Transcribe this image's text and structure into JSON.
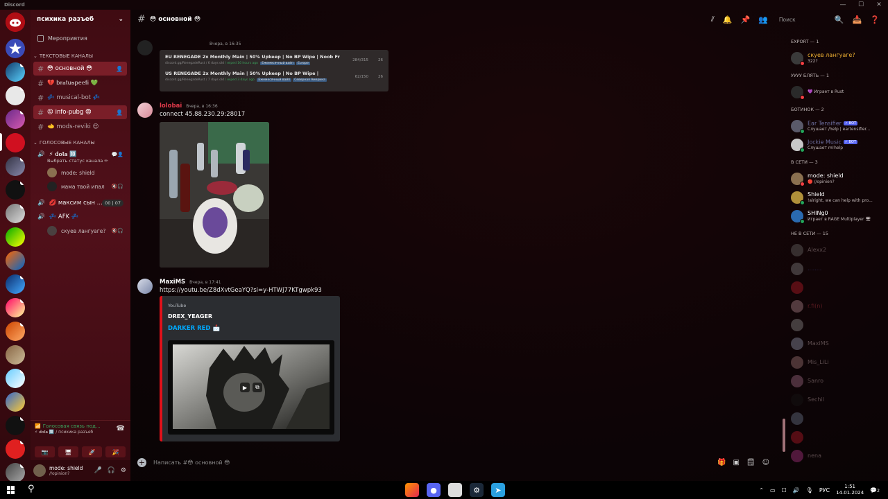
{
  "window": {
    "title": "Discord",
    "controls": [
      "—",
      "☐",
      "✕"
    ]
  },
  "server": {
    "name": "психика разъеб",
    "events_label": "Мероприятия"
  },
  "categories": {
    "text": "ТЕКСТОВЫЕ КАНАЛЫ",
    "voice": "ГОЛОСОВЫЕ КАНАЛЫ"
  },
  "text_channels": [
    {
      "label": "😳 основной 😳",
      "active": true
    },
    {
      "label": "💔 𝐛𝐫𝐚𝐭𝐮𝐬𝐩𝐞𝐞𝐟𝐢 💚",
      "active": false
    },
    {
      "label": "💤 musical-bot 💤",
      "active": false
    },
    {
      "label": "😡 info-pubg 😨",
      "active": true
    },
    {
      "label": "🫲 mods-reviki 😍",
      "active": false
    }
  ],
  "voice_channels": {
    "dota": {
      "label": "⚡ 𝐝𝐨𝐭𝐚 🔟",
      "status": "Выбрать статус канала ✏",
      "users": [
        "mode: shield",
        "мама твой ипал"
      ]
    },
    "maksim": {
      "label": "💋 максим сын ...",
      "counter": [
        "00",
        "07"
      ]
    },
    "afk": {
      "label": "💤 AFK 💤",
      "users": [
        "скуев лангуаге?"
      ]
    }
  },
  "voice_panel": {
    "status": "Голосовая связь под...",
    "sub": "⚡ 𝐝𝐨𝐭𝐚 🔟 / психика разъеб"
  },
  "user_panel": {
    "name": "mode: shield",
    "status": "//opinion?"
  },
  "channel": {
    "name": "😳 основной 😳",
    "search_placeholder": "Поиск",
    "composer_placeholder": "Написать #😳 основной 😳"
  },
  "messages": {
    "server_list_bot": {
      "time": "Вчера, в 16:35",
      "rows": [
        {
          "title": "EU RENEGADE 2x Monthly Main | 50% Upkeep | No BP Wipe | Noob Fr",
          "link": "discord.gg/RenegadeRust",
          "age": "/ 6 days old",
          "wiped": "/ wiped 16 hours ago",
          "tag1": "Ежемесячный вайп",
          "tag2": "Europe",
          "players": "284/315",
          "queue": "26"
        },
        {
          "title": "US RENEGADE 2x Monthly Main | 50% Upkeep | No BP Wipe |",
          "link": "discord.gg/RenegadeRust",
          "age": "/ 7 days old",
          "wiped": "/ wiped 3 days ago",
          "tag1": "Ежемесячный вайп",
          "tag2": "Северная Америка",
          "players": "62/150",
          "queue": "26"
        }
      ]
    },
    "lolobai": {
      "author": "lolobai",
      "author_color": "#e03a4a",
      "time": "Вчера, в 16:36",
      "text": "connect 45.88.230.29:28017"
    },
    "maxims": {
      "author": "MaxiMS",
      "author_color": "#ffffff",
      "time": "Вчера, в 17:41",
      "link": "https://youtu.be/Z8dXvtGeaYQ?si=y-HTWj77KTgwpk93",
      "embed": {
        "provider": "YouTube",
        "channel": "DREX_YEAGER",
        "title": "DARKER RED 📩"
      }
    }
  },
  "members": {
    "export": {
      "header": "EXPORT — 1",
      "list": [
        {
          "name": "скуев лангуаге?",
          "activity": "322?",
          "color": "#f0b132",
          "status": "#f23f43"
        }
      ]
    },
    "yyyy": {
      "header": "УУУУ БЛЯТЬ — 1",
      "list": [
        {
          "name": "",
          "activity": "💜 Играет в Rust",
          "color": "#ffffff",
          "status": "#f23f43"
        }
      ]
    },
    "botinok": {
      "header": "БОТИНОК — 2",
      "list": [
        {
          "name": "Ear Tensifier",
          "activity": "Слушает /help | eartensifier...",
          "color": "#6d6f9f",
          "status": "#23a55a",
          "bot": "✓ BOT"
        },
        {
          "name": "Jockie Music",
          "activity": "Слушает m!help",
          "color": "#6d6f9f",
          "status": "#23a55a",
          "bot": "✓ BOT"
        }
      ]
    },
    "online": {
      "header": "В СЕТИ — 3",
      "list": [
        {
          "name": "mode: shield",
          "activity": "🔴 //opinion?",
          "color": "#ffffff",
          "status": "#f23f43"
        },
        {
          "name": "Shield",
          "activity": "!alright, we can help with pro...",
          "color": "#ffffff",
          "status": "#23a55a"
        },
        {
          "name": "SHINg0",
          "activity": "Играет в RAGE Multiplayer 🖥",
          "color": "#ffffff",
          "status": "#23a55a"
        }
      ]
    },
    "offline": {
      "header": "НЕ В СЕТИ — 15",
      "list": [
        {
          "name": "Alexx2"
        },
        {
          "name": "........"
        },
        {
          "name": ""
        },
        {
          "name": "r.fi(n)"
        },
        {
          "name": ""
        },
        {
          "name": "MaxiMS"
        },
        {
          "name": "Mis_LiLi"
        },
        {
          "name": "Sanro"
        },
        {
          "name": "Sechil"
        },
        {
          "name": ""
        },
        {
          "name": ""
        },
        {
          "name": "nena"
        }
      ]
    }
  },
  "taskbar": {
    "lang": "РУС",
    "time": "1:51",
    "date": "14.01.2024",
    "notif": "2"
  }
}
